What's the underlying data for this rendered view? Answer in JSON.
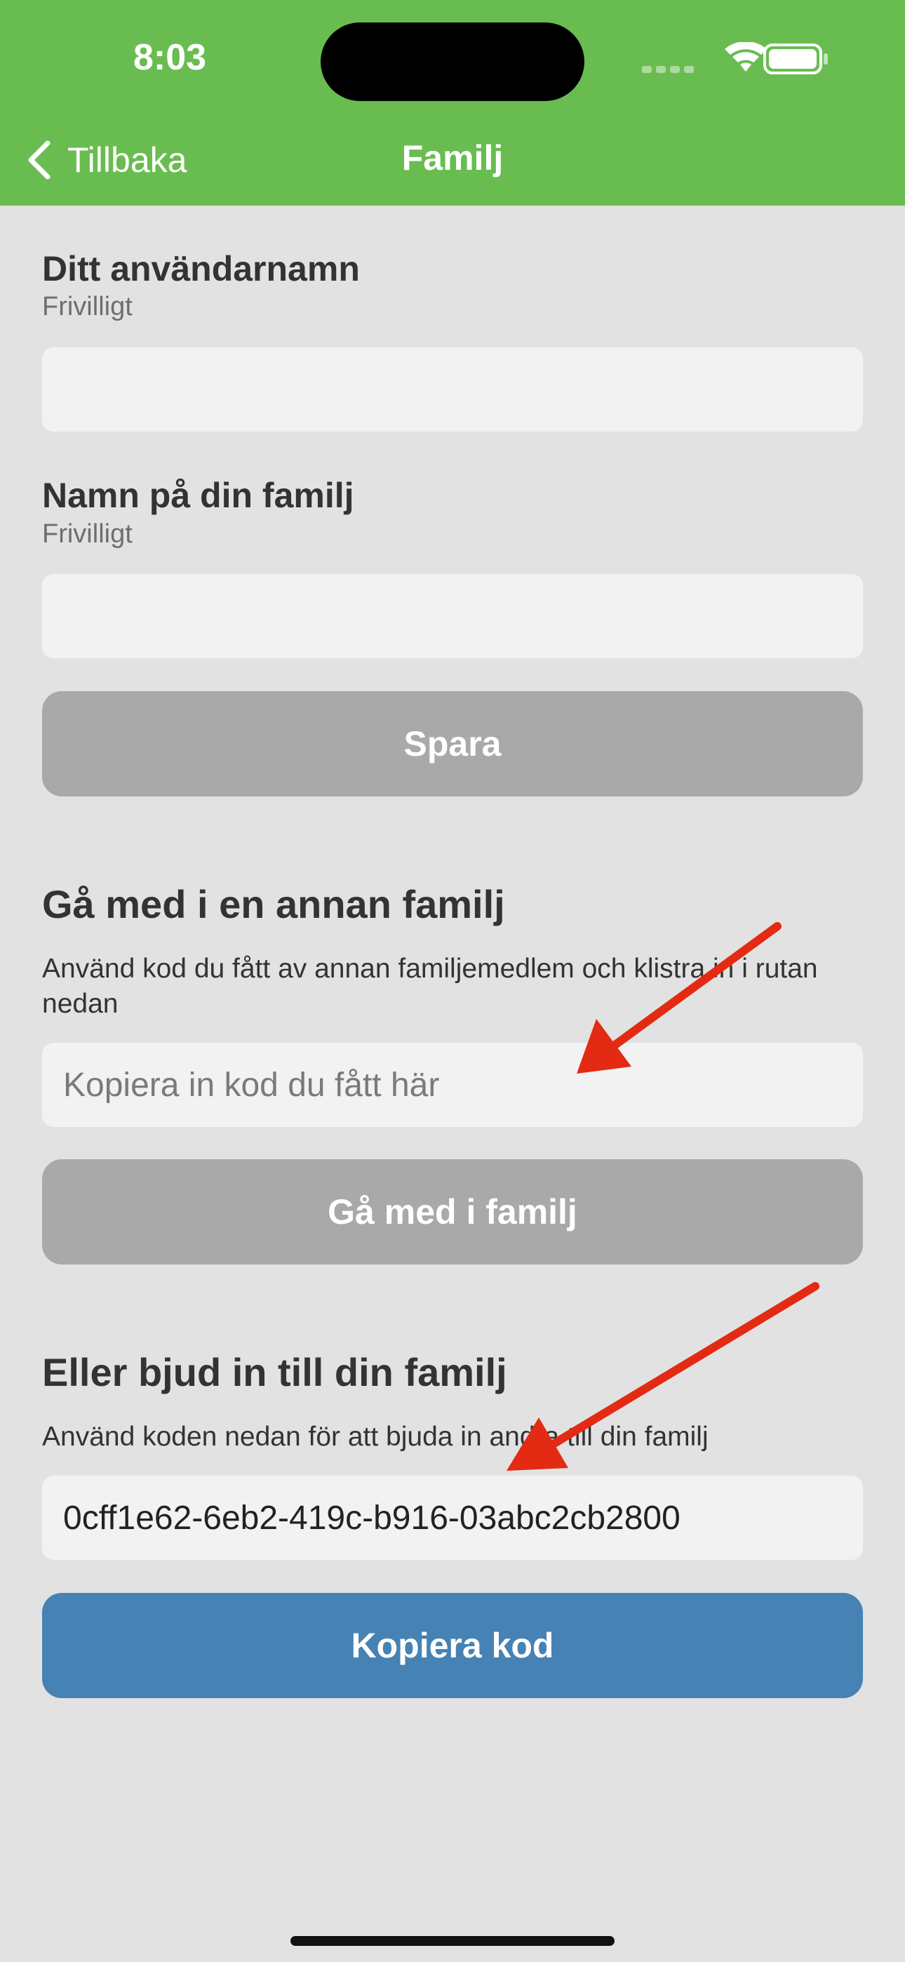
{
  "status_bar": {
    "time": "8:03"
  },
  "nav": {
    "back_label": "Tillbaka",
    "title": "Familj"
  },
  "username": {
    "label": "Ditt användarnamn",
    "hint": "Frivilligt",
    "value": ""
  },
  "family_name": {
    "label": "Namn på din familj",
    "hint": "Frivilligt",
    "value": ""
  },
  "save_button": "Spara",
  "join": {
    "heading": "Gå med i en annan familj",
    "description": "Använd kod du fått av annan familjemedlem och klistra in i rutan nedan",
    "placeholder": "Kopiera in kod du fått här",
    "button": "Gå med i familj"
  },
  "invite": {
    "heading": "Eller bjud in till din familj",
    "description": "Använd koden nedan för att bjuda in andra till din familj",
    "code": "0cff1e62-6eb2-419c-b916-03abc2cb2800",
    "button": "Kopiera kod"
  },
  "colors": {
    "header": "#69bd50",
    "background": "#e2e2e2",
    "button_disabled": "#a9a9a9",
    "button_primary": "#4682b4",
    "annotation_arrow": "#e32a12"
  }
}
